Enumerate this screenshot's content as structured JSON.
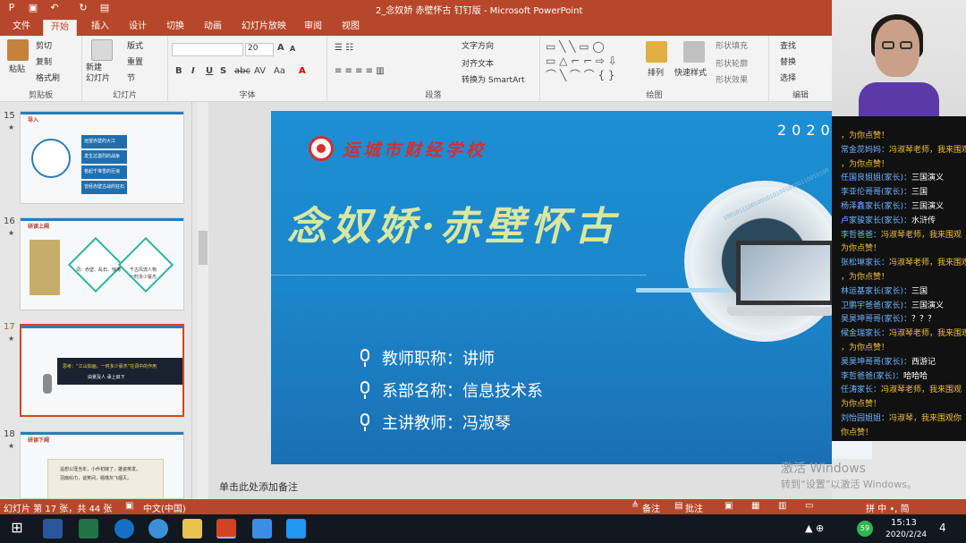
{
  "titlebar": {
    "title": "2_念奴娇 赤壁怀古 钉钉版 - Microsoft PowerPoint"
  },
  "tabs": [
    "文件",
    "开始",
    "插入",
    "设计",
    "切换",
    "动画",
    "幻灯片放映",
    "审阅",
    "视图"
  ],
  "ribbon": {
    "clipboard": {
      "label": "剪贴板",
      "paste": "粘贴",
      "cut": "剪切",
      "copy": "复制",
      "format_painter": "格式刷"
    },
    "slides": {
      "label": "幻灯片",
      "new_slide": "新建\n幻灯片",
      "layout": "版式",
      "reset": "重置",
      "section": "节"
    },
    "font": {
      "label": "字体",
      "size": "20",
      "bold": "B",
      "italic": "I",
      "underline": "U",
      "strike": "S",
      "abc": "abc",
      "spacing": "AV",
      "case": "Aa",
      "size_up": "A",
      "size_down": "A"
    },
    "paragraph": {
      "label": "段落",
      "text_direction": "文字方向",
      "align_text": "对齐文本",
      "smartart": "转换为 SmartArt"
    },
    "drawing": {
      "label": "绘图",
      "arrange": "排列",
      "quick_styles": "快速样式",
      "shape_fill": "形状填充",
      "shape_outline": "形状轮廓",
      "shape_effects": "形状效果"
    },
    "editing": {
      "label": "编辑",
      "find": "查找",
      "replace": "替换",
      "select": "选择"
    }
  },
  "slides_panel": [
    {
      "num": "15",
      "star": "★",
      "head": "导入",
      "lines": [
        "远望赤壁的大江",
        "发生过激烈的战争",
        "卷起千堆雪的巨浪",
        "曾经赤壁古战的狂石"
      ]
    },
    {
      "num": "16",
      "star": "★",
      "head": "研读上阕",
      "lines": [
        "词：赤壁、乱石、惊涛",
        "千古风流人物",
        "一时多少豪杰"
      ]
    },
    {
      "num": "17",
      "star": "★",
      "head": "",
      "lines": [
        "思考：“江山如画，一时多少豪杰”在词中的作用",
        "由景及人  承上启下"
      ]
    },
    {
      "num": "18",
      "star": "★",
      "head": "研读下阕",
      "lines": [
        "遥想公瑾当年，小乔初嫁了，雄姿英发。",
        "羽扇纶巾，谈笑间，樯橹灰飞烟灭。"
      ]
    }
  ],
  "slide": {
    "school": "运城市财经学校",
    "year": "2020",
    "title": "念奴娇·赤壁怀古",
    "info": [
      "教师职称：讲师",
      "系部名称：信息技术系",
      "主讲教师：冯淑琴"
    ],
    "binary": "1001011100100101010010100110010100"
  },
  "notes": "单击此处添加备注",
  "watermark": {
    "line1": "激活 Windows",
    "line2": "转到“设置”以激活 Windows。"
  },
  "statusbar": {
    "slide_info": "幻灯片 第 17 张，共 44 张",
    "language": "中文(中国)",
    "notes_btn": "备注",
    "comments_btn": "批注",
    "ime": "拼 中 •, 简"
  },
  "taskbar": {
    "time": "15:13",
    "date": "2020/2/24",
    "badge": "59",
    "notif": "4"
  },
  "chat": [
    {
      "name": "",
      "msg": "，为你点赞！",
      "y": true
    },
    {
      "name": "常金蕊妈妈：",
      "msg": "冯淑琴老师，我来围观",
      "y": true
    },
    {
      "name": "",
      "msg": "，为你点赞！",
      "y": true
    },
    {
      "name": "任国良姐姐(家长)：",
      "msg": "三国演义"
    },
    {
      "name": "李亚伦哥哥(家长)：",
      "msg": "三国"
    },
    {
      "name": "杨泽鑫家长(家长)：",
      "msg": "三国演义"
    },
    {
      "name": "卢家骏家长(家长)：",
      "msg": "水浒传"
    },
    {
      "name": "李哲爸爸：",
      "msg": "冯淑琴老师，我来围观",
      "y": true
    },
    {
      "name": "",
      "msg": "为你点赞！",
      "y": true
    },
    {
      "name": "张松琳家长：",
      "msg": "冯淑琴老师，我来围观",
      "y": true
    },
    {
      "name": "",
      "msg": "，为你点赞！",
      "y": true
    },
    {
      "name": "林运基家长(家长)：",
      "msg": "三国"
    },
    {
      "name": "卫鹏宇爸爸(家长)：",
      "msg": "三国演义"
    },
    {
      "name": "昊昊坤哥哥(家长)：",
      "msg": "？？？"
    },
    {
      "name": "候金瑞家长：",
      "msg": "冯淑琴老师，我来围观",
      "y": true
    },
    {
      "name": "",
      "msg": "，为你点赞！",
      "y": true
    },
    {
      "name": "昊昊坤哥哥(家长)：",
      "msg": "西游记"
    },
    {
      "name": "李哲爸爸(家长)：",
      "msg": "哈哈哈"
    },
    {
      "name": "任涛家长：",
      "msg": "冯淑琴老师，我来围观",
      "y": true
    },
    {
      "name": "",
      "msg": "为你点赞！",
      "y": true
    },
    {
      "name": "刘怡园姐姐：",
      "msg": "冯淑琴，我来围观你",
      "y": true
    },
    {
      "name": "",
      "msg": "你点赞！",
      "y": true
    }
  ]
}
